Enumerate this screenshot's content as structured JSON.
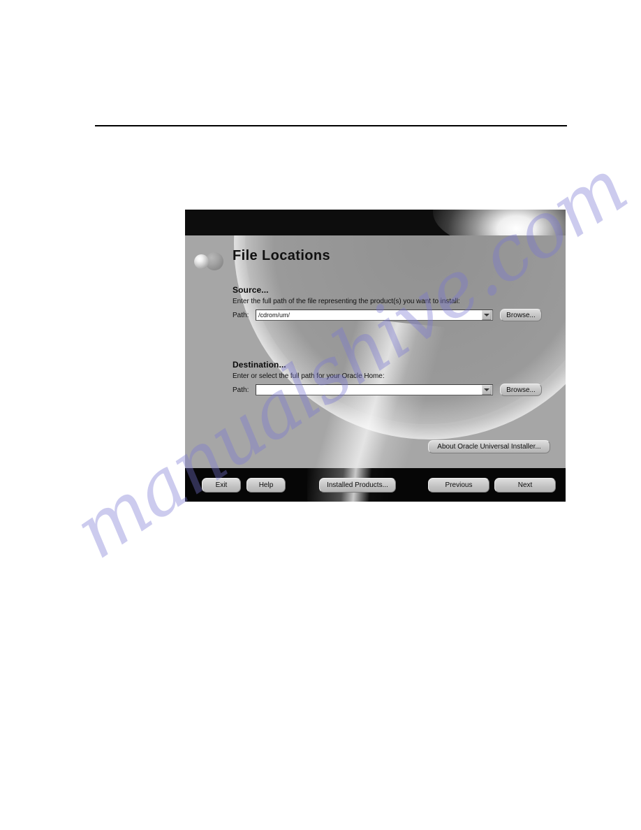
{
  "page": {
    "background_color": "#ffffff",
    "rule_color": "#000000",
    "watermark": "manualshive.com",
    "watermark_color": "#7876d2"
  },
  "installer": {
    "title": "File Locations",
    "logo_icon": "oracle-spheres-icon",
    "header_color": "#0d0d0d",
    "panel_color": "#a6a6a6",
    "source": {
      "heading": "Source...",
      "description": "Enter the full path of the file representing the product(s) you want to install:",
      "path_label": "Path:",
      "path_value": "/cdrom/um/",
      "path_placeholder": "",
      "browse_label": "Browse...",
      "dropdown_icon": "chevron-down-icon"
    },
    "destination": {
      "heading": "Destination...",
      "description": "Enter or select the full path for your Oracle Home:",
      "path_label": "Path:",
      "path_value": "",
      "path_placeholder": "",
      "browse_label": "Browse...",
      "dropdown_icon": "chevron-down-icon"
    },
    "about_button": "About Oracle Universal Installer...",
    "footer": {
      "exit": "Exit",
      "help": "Help",
      "installed_products": "Installed Products...",
      "previous": "Previous",
      "next": "Next"
    }
  }
}
